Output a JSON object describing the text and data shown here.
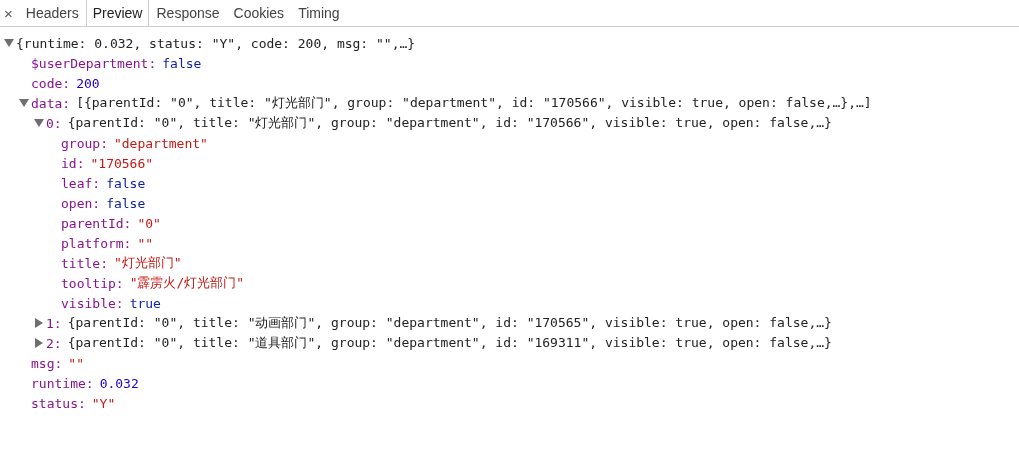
{
  "toolbar": {
    "close": "×",
    "tabs": [
      {
        "label": "Headers",
        "selected": false
      },
      {
        "label": "Preview",
        "selected": true
      },
      {
        "label": "Response",
        "selected": false
      },
      {
        "label": "Cookies",
        "selected": false
      },
      {
        "label": "Timing",
        "selected": false
      }
    ]
  },
  "tree": {
    "value": "{runtime: 0.032, status: \"Y\", code: 200, msg: \"\",…}",
    "kind": "summary",
    "expanded": true,
    "children": [
      {
        "key": "$userDepartment:",
        "value": "false",
        "kind": "boolean"
      },
      {
        "key": "code:",
        "value": "200",
        "kind": "number"
      },
      {
        "key": "data:",
        "value": "[{parentId: \"0\", title: \"灯光部门\", group: \"department\", id: \"170566\", visible: true, open: false,…},…]",
        "kind": "summary",
        "expanded": true,
        "children": [
          {
            "key": "0:",
            "value": "{parentId: \"0\", title: \"灯光部门\", group: \"department\", id: \"170566\", visible: true, open: false,…}",
            "kind": "summary",
            "expanded": true,
            "children": [
              {
                "key": "group:",
                "value": "\"department\"",
                "kind": "string"
              },
              {
                "key": "id:",
                "value": "\"170566\"",
                "kind": "string"
              },
              {
                "key": "leaf:",
                "value": "false",
                "kind": "boolean"
              },
              {
                "key": "open:",
                "value": "false",
                "kind": "boolean"
              },
              {
                "key": "parentId:",
                "value": "\"0\"",
                "kind": "string"
              },
              {
                "key": "platform:",
                "value": "\"\"",
                "kind": "string"
              },
              {
                "key": "title:",
                "value": "\"灯光部门\"",
                "kind": "string"
              },
              {
                "key": "tooltip:",
                "value": "\"霹雳火/灯光部门\"",
                "kind": "string"
              },
              {
                "key": "visible:",
                "value": "true",
                "kind": "boolean"
              }
            ]
          },
          {
            "key": "1:",
            "value": "{parentId: \"0\", title: \"动画部门\", group: \"department\", id: \"170565\", visible: true, open: false,…}",
            "kind": "summary",
            "expanded": false
          },
          {
            "key": "2:",
            "value": "{parentId: \"0\", title: \"道具部门\", group: \"department\", id: \"169311\", visible: true, open: false,…}",
            "kind": "summary",
            "expanded": false
          }
        ]
      },
      {
        "key": "msg:",
        "value": "\"\"",
        "kind": "string"
      },
      {
        "key": "runtime:",
        "value": "0.032",
        "kind": "number"
      },
      {
        "key": "status:",
        "value": "\"Y\"",
        "kind": "string"
      }
    ]
  }
}
